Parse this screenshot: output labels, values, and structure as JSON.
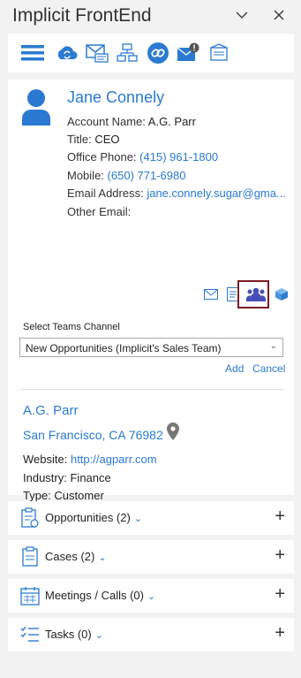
{
  "window": {
    "title": "Implicit FrontEnd",
    "minimize_icon": "chevron-down-icon",
    "close_icon": "close-icon"
  },
  "toolbar": {
    "icons": [
      "menu-icon",
      "sync-icon",
      "email-compose-icon",
      "org-chart-icon",
      "link-icon",
      "mail-alert-icon",
      "mail-settings-icon"
    ]
  },
  "contact": {
    "name": "Jane Connely",
    "fields": [
      {
        "label": "Account Name:",
        "value": "A.G. Parr",
        "link": false
      },
      {
        "label": "Title:",
        "value": "CEO",
        "link": false
      },
      {
        "label": "Office Phone:",
        "value": "(415) 961-1800",
        "link": true
      },
      {
        "label": "Mobile:",
        "value": "(650) 771-6980",
        "link": true
      },
      {
        "label": "Email Address:",
        "value": "jane.connely.sugar@gma...",
        "link": true
      },
      {
        "label": "Other Email:",
        "value": "",
        "link": false
      }
    ]
  },
  "teams": {
    "select_label": "Select Teams Channel",
    "selected_channel": "New Opportunities (Implicit's Sales Team)",
    "add_label": "Add",
    "cancel_label": "Cancel"
  },
  "account": {
    "name": "A.G. Parr",
    "location": "San Francisco, CA 76982",
    "website_label": "Website:",
    "website": "http://agparr.com",
    "industry_label": "Industry:",
    "industry": "Finance",
    "type_label": "Type:",
    "type": "Customer"
  },
  "sections": [
    {
      "label": "Opportunities (2)",
      "icon": "opportunities-icon"
    },
    {
      "label": "Cases (2)",
      "icon": "cases-icon"
    },
    {
      "label": "Meetings / Calls (0)",
      "icon": "calendar-icon"
    },
    {
      "label": "Tasks (0)",
      "icon": "tasks-icon"
    }
  ],
  "colors": {
    "accent": "#2a7ad2",
    "teams": "#464eb8",
    "highlight_border": "#7b1c24"
  }
}
